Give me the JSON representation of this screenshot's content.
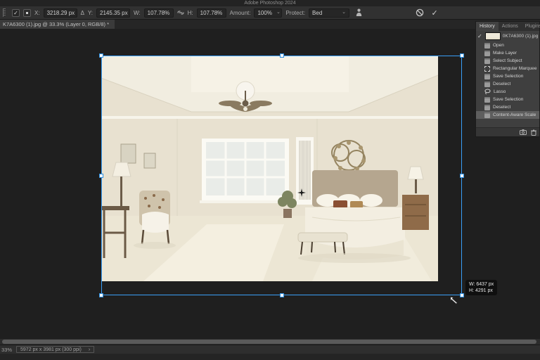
{
  "app": {
    "title": "Adobe Photoshop 2024"
  },
  "options_bar": {
    "x_label": "X:",
    "x_value": "3218.29 px",
    "y_label": "Y:",
    "y_value": "2145.35 px",
    "w_label": "W:",
    "w_value": "107.78%",
    "h_label": "H:",
    "h_value": "107.78%",
    "amount_label": "Amount:",
    "amount_value": "100%",
    "protect_label": "Protect:",
    "protect_value": "Bed",
    "check_glyph": "✓",
    "delta_glyph": "Δ",
    "chevron_glyph": "⌄",
    "commit_glyph": "✓"
  },
  "document_tab": {
    "label": "K7A6300 (1).jpg @ 33.3% (Layer 0, RGB/8) *"
  },
  "history_panel": {
    "tabs": [
      {
        "label": "History"
      },
      {
        "label": "Actions"
      },
      {
        "label": "Plugins"
      }
    ],
    "snapshot": {
      "check_glyph": "✓",
      "label": "0K7A6300 (1).jpg"
    },
    "items": [
      {
        "label": "Open",
        "icon": "state"
      },
      {
        "label": "Make Layer",
        "icon": "state"
      },
      {
        "label": "Select Subject",
        "icon": "state"
      },
      {
        "label": "Rectangular Marquee",
        "icon": "marquee"
      },
      {
        "label": "Save Selection",
        "icon": "state"
      },
      {
        "label": "Deselect",
        "icon": "state"
      },
      {
        "label": "Lasso",
        "icon": "lasso"
      },
      {
        "label": "Save Selection",
        "icon": "state"
      },
      {
        "label": "Deselect",
        "icon": "state"
      },
      {
        "label": "Content-Aware Scale",
        "icon": "state",
        "selected": true
      }
    ]
  },
  "transform": {
    "tooltip_w": "W: 6437 px",
    "tooltip_h": "H: 4291 px",
    "scale_percent": "107.78%"
  },
  "status_bar": {
    "zoom": "33%",
    "doc_info": "5972 px x 3981 px (300 ppi)",
    "chevron": "›"
  },
  "colors": {
    "accent_blue": "#3aa0f8",
    "selection_highlight": "#5e5e5e",
    "ui_dark": "#1f1f1f"
  }
}
